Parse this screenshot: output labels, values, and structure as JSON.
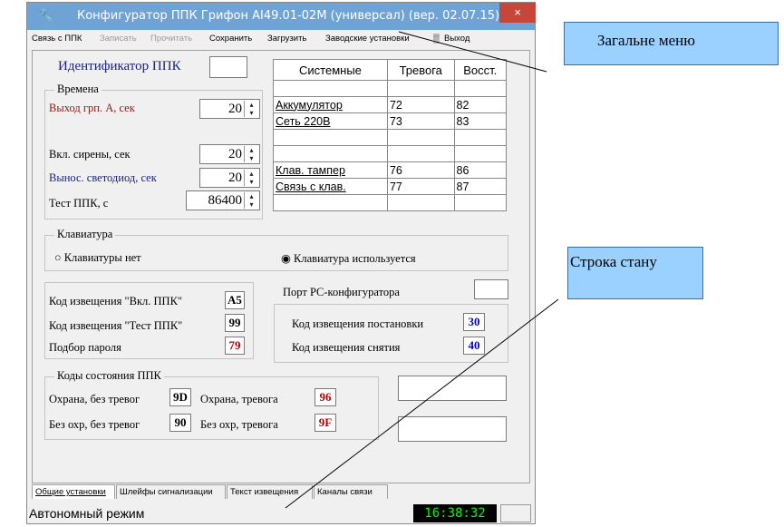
{
  "window": {
    "title": "Конфигуратор ППК Грифон AI49.01-02M (универсал) (вер. 02.07.15)",
    "close_glyph": "×"
  },
  "menu": {
    "items": [
      "Связь с ППК",
      "Записать",
      "Прочитать",
      "Сохранить",
      "Загрузить",
      "Заводские установки",
      "Выход"
    ]
  },
  "identifier": {
    "label": "Идентификатор ППК",
    "value": ""
  },
  "times": {
    "title": "Времена",
    "exit_group_a": {
      "label": "Выход  грп. А, сек",
      "value": "20"
    },
    "siren": {
      "label": "Вкл. сирены, сек",
      "value": "20"
    },
    "led": {
      "label": "Вынос. светодиод, сек",
      "value": "20"
    },
    "test": {
      "label": "Тест ППК,  с",
      "value": "86400"
    }
  },
  "system_table": {
    "headers": [
      "Системные",
      "Тревога",
      "Восст."
    ],
    "rows": [
      [
        "",
        "",
        ""
      ],
      [
        "Аккумулятор",
        "72",
        "82"
      ],
      [
        "Сеть 220В",
        "73",
        "83"
      ],
      [
        "",
        "",
        ""
      ],
      [
        "",
        "",
        ""
      ],
      [
        "Клав. тампер",
        "76",
        "86"
      ],
      [
        "Связь с клав.",
        "77",
        "87"
      ],
      [
        "",
        "",
        ""
      ]
    ]
  },
  "keyboard": {
    "title": "Клавиатура",
    "option_none": "Клавиатуры нет",
    "option_used": "Клавиатура используется",
    "selected": "Клавиатура используется"
  },
  "notification_codes": {
    "on_ppk": {
      "label": "Код извещения \"Вкл. ППК\"",
      "value": "A5"
    },
    "test_ppk": {
      "label": "Код извещения \"Тест ППК\"",
      "value": "99"
    },
    "password": {
      "label": "Подбор пароля",
      "value": "79"
    }
  },
  "pc_port": {
    "label": "Порт РС-конфигуратора",
    "value": ""
  },
  "arm_codes": {
    "arm": {
      "label": "Код извещения постановки",
      "value": "30"
    },
    "disarm": {
      "label": "Код извещения снятия",
      "value": "40"
    }
  },
  "state_codes": {
    "title": "Коды состояния ППК",
    "guard_no_alarm": {
      "label": "Охрана, без тревог",
      "value": "9D"
    },
    "guard_alarm": {
      "label": "Охрана, тревога",
      "value": "96"
    },
    "noguard_no_alarm": {
      "label": "Без охр, без тревог",
      "value": "90"
    },
    "noguard_alarm": {
      "label": "Без охр, тревога",
      "value": "9F"
    }
  },
  "tabs": [
    "Общие установки",
    "Шлейфы сигнализации",
    "Текст извещения",
    "Каналы связи"
  ],
  "active_tab": "Общие установки",
  "status": {
    "mode": "Автономный режим",
    "clock": "16:38:32"
  },
  "callouts": {
    "menu": "Загальне меню",
    "status": "Строка стану"
  },
  "colors": {
    "titlebar": "#6fa3d6",
    "close": "#c7463a",
    "callout": "#9bd1ff",
    "clock_fg": "#00ff00",
    "code_red": "#c00000",
    "code_blue": "#0000cc"
  },
  "icons": [
    "wrench-icon",
    "close-icon",
    "exit-icon",
    "spin-updown-icon",
    "radio-icon"
  ]
}
